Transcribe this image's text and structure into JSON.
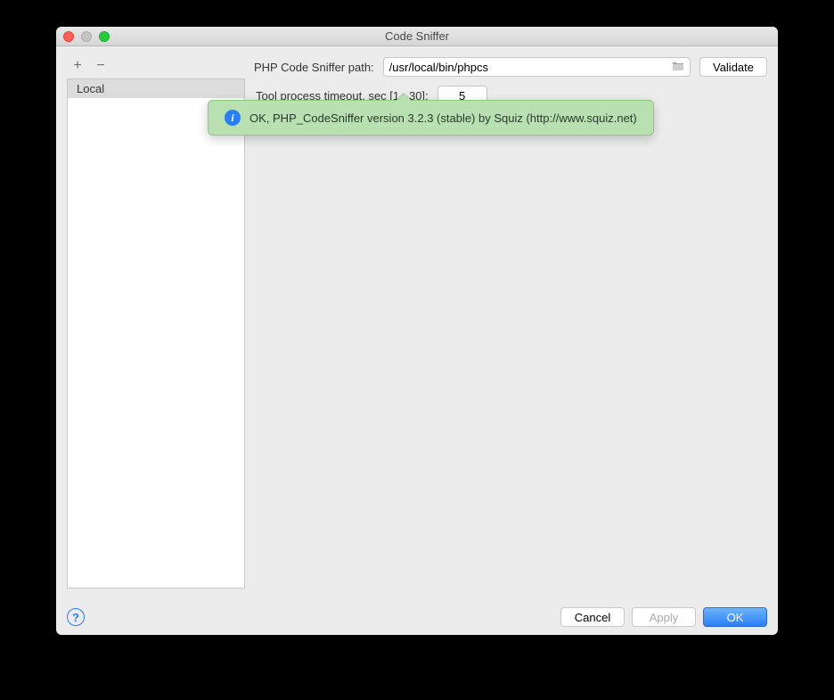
{
  "window": {
    "title": "Code Sniffer"
  },
  "sidebar": {
    "items": [
      {
        "label": "Local"
      }
    ]
  },
  "main": {
    "path_label": "PHP Code Sniffer path:",
    "path_value": "/usr/local/bin/phpcs",
    "validate_label": "Validate",
    "timeout_label": "Tool process timeout, sec [1...30]:",
    "timeout_value": "5"
  },
  "tooltip": {
    "message": "OK, PHP_CodeSniffer version 3.2.3 (stable) by Squiz (http://www.squiz.net)"
  },
  "footer": {
    "cancel": "Cancel",
    "apply": "Apply",
    "ok": "OK"
  }
}
